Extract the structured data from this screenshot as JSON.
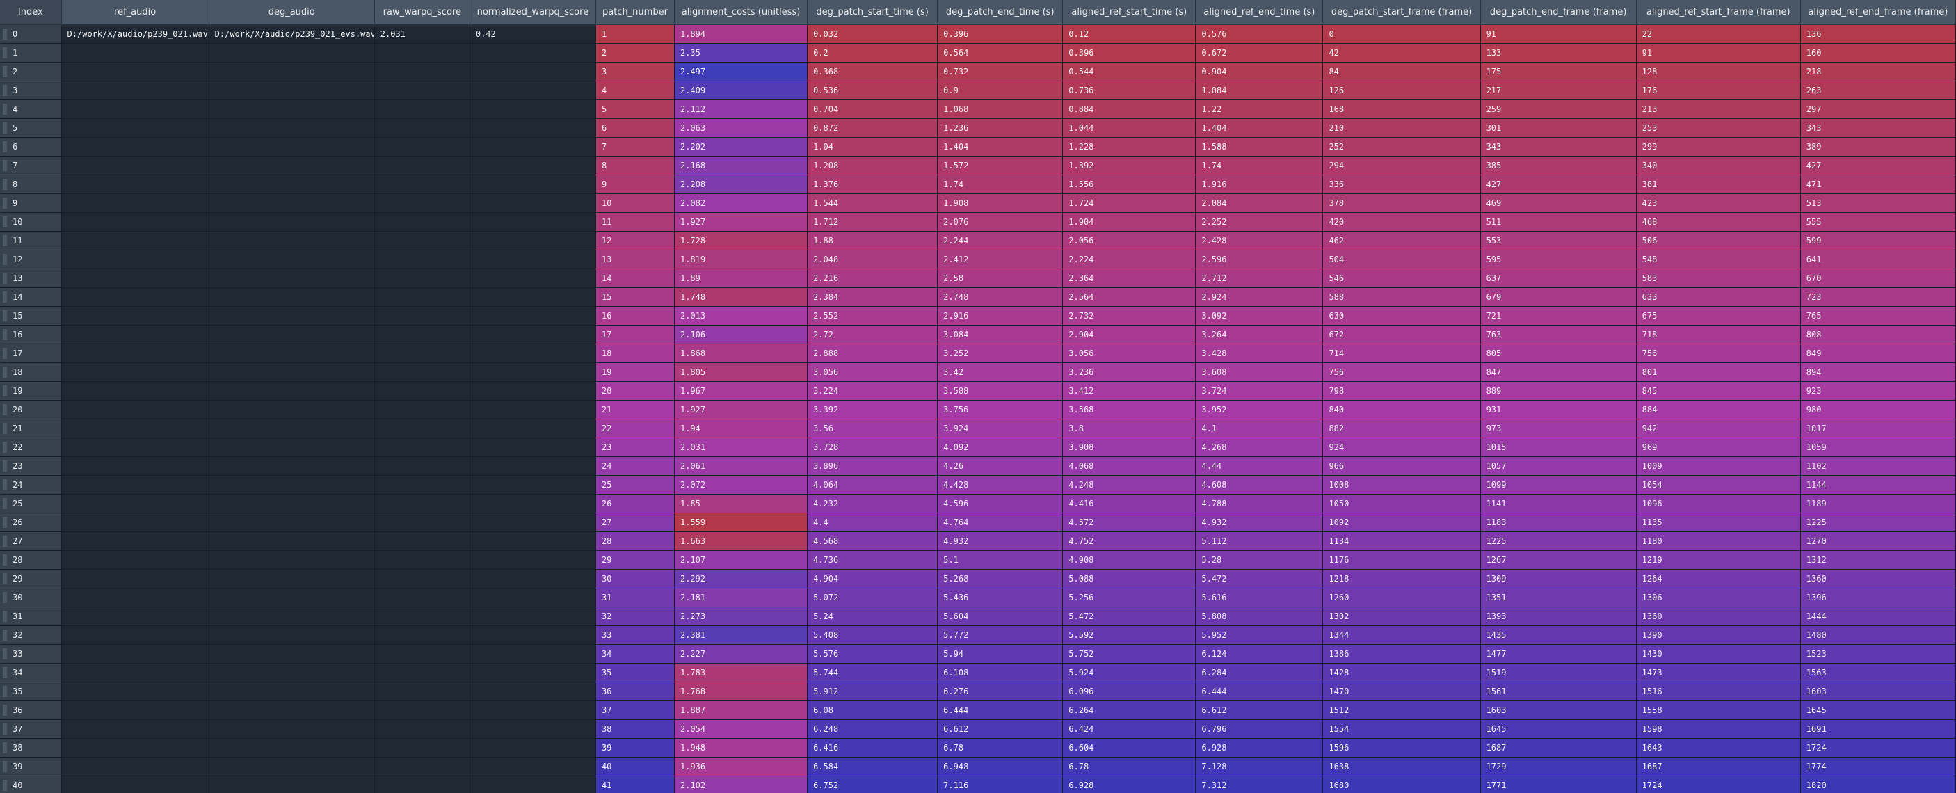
{
  "columns": [
    "Index",
    "ref_audio",
    "deg_audio",
    "raw_warpq_score",
    "normalized_warpq_score",
    "patch_number",
    "alignment_costs (unitless)",
    "deg_patch_start_time (s)",
    "deg_patch_end_time (s)",
    "aligned_ref_start_time (s)",
    "aligned_ref_end_time (s)",
    "deg_patch_start_frame (frame)",
    "deg_patch_end_frame (frame)",
    "aligned_ref_start_frame (frame)",
    "aligned_ref_end_frame (frame)"
  ],
  "rows": [
    [
      "0",
      "D:/work/X/audio/p239_021.wav",
      "D:/work/X/audio/p239_021_evs.wav",
      "2.031",
      "0.42",
      "1",
      "1.894",
      "0.032",
      "0.396",
      "0.12",
      "0.576",
      "0",
      "91",
      "22",
      "136"
    ],
    [
      "1",
      "",
      "",
      "",
      "",
      "2",
      "2.35",
      "0.2",
      "0.564",
      "0.396",
      "0.672",
      "42",
      "133",
      "91",
      "160"
    ],
    [
      "2",
      "",
      "",
      "",
      "",
      "3",
      "2.497",
      "0.368",
      "0.732",
      "0.544",
      "0.904",
      "84",
      "175",
      "128",
      "218"
    ],
    [
      "3",
      "",
      "",
      "",
      "",
      "4",
      "2.409",
      "0.536",
      "0.9",
      "0.736",
      "1.084",
      "126",
      "217",
      "176",
      "263"
    ],
    [
      "4",
      "",
      "",
      "",
      "",
      "5",
      "2.112",
      "0.704",
      "1.068",
      "0.884",
      "1.22",
      "168",
      "259",
      "213",
      "297"
    ],
    [
      "5",
      "",
      "",
      "",
      "",
      "6",
      "2.063",
      "0.872",
      "1.236",
      "1.044",
      "1.404",
      "210",
      "301",
      "253",
      "343"
    ],
    [
      "6",
      "",
      "",
      "",
      "",
      "7",
      "2.202",
      "1.04",
      "1.404",
      "1.228",
      "1.588",
      "252",
      "343",
      "299",
      "389"
    ],
    [
      "7",
      "",
      "",
      "",
      "",
      "8",
      "2.168",
      "1.208",
      "1.572",
      "1.392",
      "1.74",
      "294",
      "385",
      "340",
      "427"
    ],
    [
      "8",
      "",
      "",
      "",
      "",
      "9",
      "2.208",
      "1.376",
      "1.74",
      "1.556",
      "1.916",
      "336",
      "427",
      "381",
      "471"
    ],
    [
      "9",
      "",
      "",
      "",
      "",
      "10",
      "2.082",
      "1.544",
      "1.908",
      "1.724",
      "2.084",
      "378",
      "469",
      "423",
      "513"
    ],
    [
      "10",
      "",
      "",
      "",
      "",
      "11",
      "1.927",
      "1.712",
      "2.076",
      "1.904",
      "2.252",
      "420",
      "511",
      "468",
      "555"
    ],
    [
      "11",
      "",
      "",
      "",
      "",
      "12",
      "1.728",
      "1.88",
      "2.244",
      "2.056",
      "2.428",
      "462",
      "553",
      "506",
      "599"
    ],
    [
      "12",
      "",
      "",
      "",
      "",
      "13",
      "1.819",
      "2.048",
      "2.412",
      "2.224",
      "2.596",
      "504",
      "595",
      "548",
      "641"
    ],
    [
      "13",
      "",
      "",
      "",
      "",
      "14",
      "1.89",
      "2.216",
      "2.58",
      "2.364",
      "2.712",
      "546",
      "637",
      "583",
      "670"
    ],
    [
      "14",
      "",
      "",
      "",
      "",
      "15",
      "1.748",
      "2.384",
      "2.748",
      "2.564",
      "2.924",
      "588",
      "679",
      "633",
      "723"
    ],
    [
      "15",
      "",
      "",
      "",
      "",
      "16",
      "2.013",
      "2.552",
      "2.916",
      "2.732",
      "3.092",
      "630",
      "721",
      "675",
      "765"
    ],
    [
      "16",
      "",
      "",
      "",
      "",
      "17",
      "2.106",
      "2.72",
      "3.084",
      "2.904",
      "3.264",
      "672",
      "763",
      "718",
      "808"
    ],
    [
      "17",
      "",
      "",
      "",
      "",
      "18",
      "1.868",
      "2.888",
      "3.252",
      "3.056",
      "3.428",
      "714",
      "805",
      "756",
      "849"
    ],
    [
      "18",
      "",
      "",
      "",
      "",
      "19",
      "1.805",
      "3.056",
      "3.42",
      "3.236",
      "3.608",
      "756",
      "847",
      "801",
      "894"
    ],
    [
      "19",
      "",
      "",
      "",
      "",
      "20",
      "1.967",
      "3.224",
      "3.588",
      "3.412",
      "3.724",
      "798",
      "889",
      "845",
      "923"
    ],
    [
      "20",
      "",
      "",
      "",
      "",
      "21",
      "1.927",
      "3.392",
      "3.756",
      "3.568",
      "3.952",
      "840",
      "931",
      "884",
      "980"
    ],
    [
      "21",
      "",
      "",
      "",
      "",
      "22",
      "1.94",
      "3.56",
      "3.924",
      "3.8",
      "4.1",
      "882",
      "973",
      "942",
      "1017"
    ],
    [
      "22",
      "",
      "",
      "",
      "",
      "23",
      "2.031",
      "3.728",
      "4.092",
      "3.908",
      "4.268",
      "924",
      "1015",
      "969",
      "1059"
    ],
    [
      "23",
      "",
      "",
      "",
      "",
      "24",
      "2.061",
      "3.896",
      "4.26",
      "4.068",
      "4.44",
      "966",
      "1057",
      "1009",
      "1102"
    ],
    [
      "24",
      "",
      "",
      "",
      "",
      "25",
      "2.072",
      "4.064",
      "4.428",
      "4.248",
      "4.608",
      "1008",
      "1099",
      "1054",
      "1144"
    ],
    [
      "25",
      "",
      "",
      "",
      "",
      "26",
      "1.85",
      "4.232",
      "4.596",
      "4.416",
      "4.788",
      "1050",
      "1141",
      "1096",
      "1189"
    ],
    [
      "26",
      "",
      "",
      "",
      "",
      "27",
      "1.559",
      "4.4",
      "4.764",
      "4.572",
      "4.932",
      "1092",
      "1183",
      "1135",
      "1225"
    ],
    [
      "27",
      "",
      "",
      "",
      "",
      "28",
      "1.663",
      "4.568",
      "4.932",
      "4.752",
      "5.112",
      "1134",
      "1225",
      "1180",
      "1270"
    ],
    [
      "28",
      "",
      "",
      "",
      "",
      "29",
      "2.107",
      "4.736",
      "5.1",
      "4.908",
      "5.28",
      "1176",
      "1267",
      "1219",
      "1312"
    ],
    [
      "29",
      "",
      "",
      "",
      "",
      "30",
      "2.292",
      "4.904",
      "5.268",
      "5.088",
      "5.472",
      "1218",
      "1309",
      "1264",
      "1360"
    ],
    [
      "30",
      "",
      "",
      "",
      "",
      "31",
      "2.181",
      "5.072",
      "5.436",
      "5.256",
      "5.616",
      "1260",
      "1351",
      "1306",
      "1396"
    ],
    [
      "31",
      "",
      "",
      "",
      "",
      "32",
      "2.273",
      "5.24",
      "5.604",
      "5.472",
      "5.808",
      "1302",
      "1393",
      "1360",
      "1444"
    ],
    [
      "32",
      "",
      "",
      "",
      "",
      "33",
      "2.381",
      "5.408",
      "5.772",
      "5.592",
      "5.952",
      "1344",
      "1435",
      "1390",
      "1480"
    ],
    [
      "33",
      "",
      "",
      "",
      "",
      "34",
      "2.227",
      "5.576",
      "5.94",
      "5.752",
      "6.124",
      "1386",
      "1477",
      "1430",
      "1523"
    ],
    [
      "34",
      "",
      "",
      "",
      "",
      "35",
      "1.783",
      "5.744",
      "6.108",
      "5.924",
      "6.284",
      "1428",
      "1519",
      "1473",
      "1563"
    ],
    [
      "35",
      "",
      "",
      "",
      "",
      "36",
      "1.768",
      "5.912",
      "6.276",
      "6.096",
      "6.444",
      "1470",
      "1561",
      "1516",
      "1603"
    ],
    [
      "36",
      "",
      "",
      "",
      "",
      "37",
      "1.887",
      "6.08",
      "6.444",
      "6.264",
      "6.612",
      "1512",
      "1603",
      "1558",
      "1645"
    ],
    [
      "37",
      "",
      "",
      "",
      "",
      "38",
      "2.054",
      "6.248",
      "6.612",
      "6.424",
      "6.796",
      "1554",
      "1645",
      "1598",
      "1691"
    ],
    [
      "38",
      "",
      "",
      "",
      "",
      "39",
      "1.948",
      "6.416",
      "6.78",
      "6.604",
      "6.928",
      "1596",
      "1687",
      "1643",
      "1724"
    ],
    [
      "39",
      "",
      "",
      "",
      "",
      "40",
      "1.936",
      "6.584",
      "6.948",
      "6.78",
      "7.128",
      "1638",
      "1729",
      "1687",
      "1774"
    ],
    [
      "40",
      "",
      "",
      "",
      "",
      "41",
      "2.102",
      "6.752",
      "7.116",
      "6.928",
      "7.312",
      "1680",
      "1771",
      "1724",
      "1820"
    ]
  ],
  "colors": {
    "header_bg": "#4a5766",
    "index_bg": "#37424f",
    "plain_bg": "#1f2833",
    "gradient_low": "#b23a4a",
    "gradient_mid": "#a53aa6",
    "gradient_high": "#3b37b5",
    "cost_low": "#b3384a",
    "cost_high": "#3f3cb8"
  }
}
